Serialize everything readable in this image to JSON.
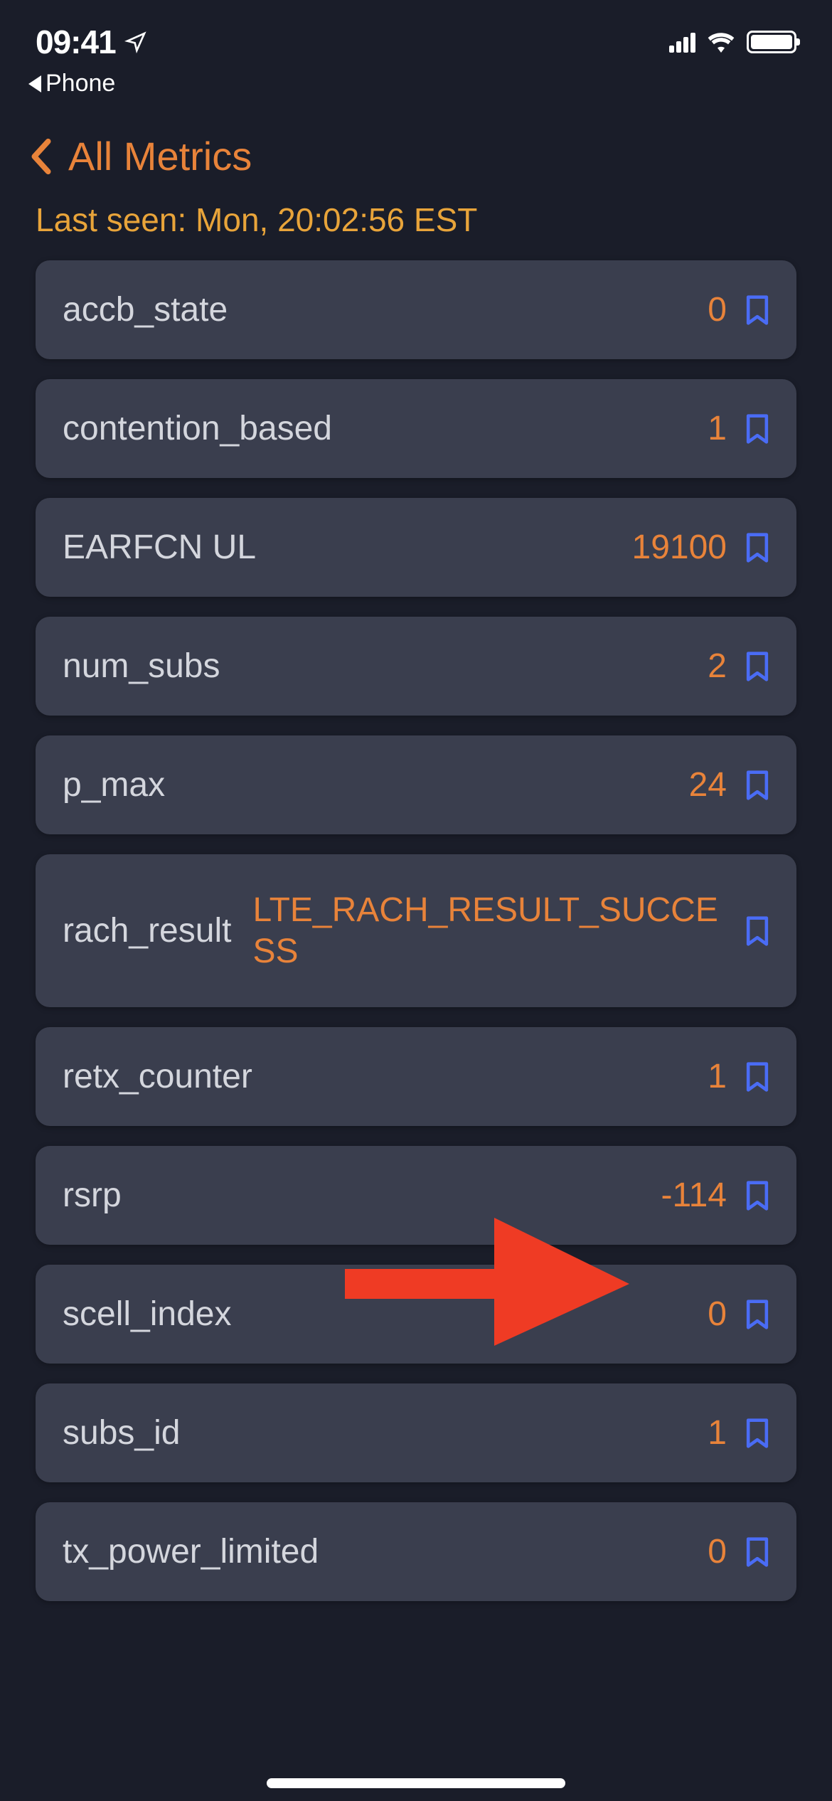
{
  "status_bar": {
    "time": "09:41",
    "back_to_app": "Phone"
  },
  "nav": {
    "back_label": "All Metrics"
  },
  "timestamp": "Last seen: Mon, 20:02:56 EST",
  "metrics": [
    {
      "name": "accb_state",
      "value": "0"
    },
    {
      "name": "contention_based",
      "value": "1"
    },
    {
      "name": "EARFCN UL",
      "value": "19100"
    },
    {
      "name": "num_subs",
      "value": "2"
    },
    {
      "name": "p_max",
      "value": "24"
    },
    {
      "name": "rach_result",
      "value": "LTE_RACH_RESULT_SUCCESS"
    },
    {
      "name": "retx_counter",
      "value": "1"
    },
    {
      "name": "rsrp",
      "value": "-114"
    },
    {
      "name": "scell_index",
      "value": "0"
    },
    {
      "name": "subs_id",
      "value": "1"
    },
    {
      "name": "tx_power_limited",
      "value": "0"
    }
  ],
  "annotation": {
    "highlighted_metric_index": 7
  }
}
